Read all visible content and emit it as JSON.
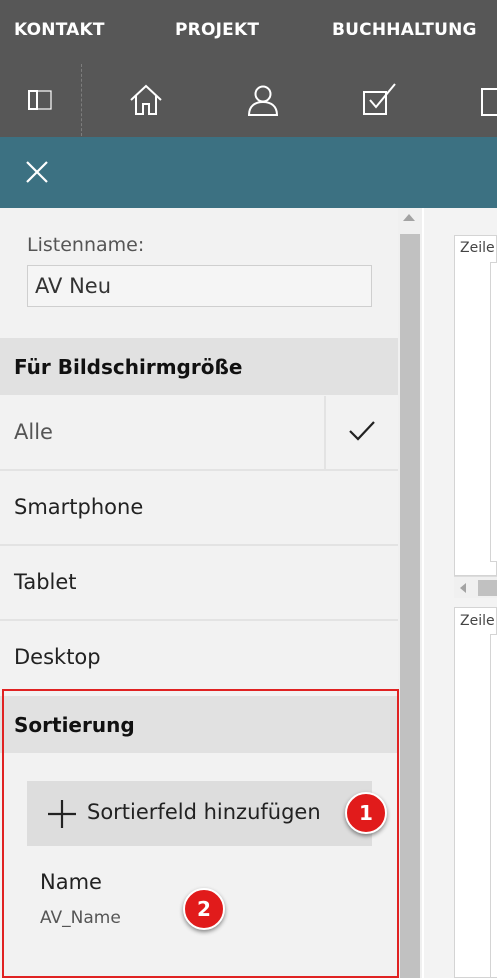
{
  "menu": {
    "items": [
      {
        "label": "KONTAKT"
      },
      {
        "label": "PROJEKT"
      },
      {
        "label": "BUCHHALTUNG"
      }
    ]
  },
  "toolbar": {
    "icons": [
      "panel-toggle-icon",
      "home-icon",
      "user-icon",
      "checkbox-icon",
      "document-icon"
    ]
  },
  "panel": {
    "list_name_label": "Listenname:",
    "list_name_value": "AV Neu",
    "screen_size": {
      "title": "Für Bildschirmgröße",
      "options": [
        {
          "label": "Alle",
          "selected": true
        },
        {
          "label": "Smartphone",
          "selected": false
        },
        {
          "label": "Tablet",
          "selected": false
        },
        {
          "label": "Desktop",
          "selected": false
        }
      ]
    },
    "sorting": {
      "title": "Sortierung",
      "add_button_label": "Sortierfeld hinzufügen",
      "fields": [
        {
          "name": "Name",
          "field": "AV_Name"
        }
      ]
    }
  },
  "background": {
    "row_label_1": "Zeile",
    "row_label_2": "Zeile"
  },
  "annotations": {
    "badge_1": "1",
    "badge_2": "2"
  },
  "colors": {
    "topbar": "#575757",
    "header": "#3c7182",
    "panel": "#f2f2f2",
    "section": "#e1e1e1",
    "highlight": "#e02222",
    "badge": "#e11b1b"
  }
}
